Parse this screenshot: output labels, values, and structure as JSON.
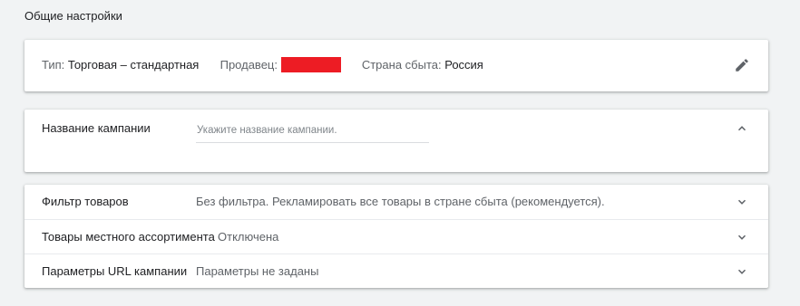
{
  "section": {
    "title": "Общие настройки"
  },
  "summary": {
    "type_label": "Тип: ",
    "type_value": "Торговая – стандартная",
    "seller_label": "Продавец: ",
    "country_label": "Страна сбыта: ",
    "country_value": "Россия",
    "redaction_color": "#ed1c24",
    "edit_icon": "pencil-icon"
  },
  "campaign_name": {
    "label": "Название кампании",
    "value": "",
    "placeholder": "Укажите название кампании.",
    "toggle_icon": "chevron-up-icon"
  },
  "rows": [
    {
      "label": "Фильтр товаров",
      "value": "Без фильтра. Рекламировать все товары в стране сбыта (рекомендуется).",
      "icon": "chevron-down-icon"
    },
    {
      "label": "Товары местного ассортимента",
      "value": "Отключена",
      "icon": "chevron-down-icon"
    },
    {
      "label": "Параметры URL кампании",
      "value": "Параметры не заданы",
      "icon": "chevron-down-icon"
    }
  ],
  "colors": {
    "background": "#f1f3f4",
    "icon": "#5f6368",
    "secondary_text": "#5f6368"
  }
}
